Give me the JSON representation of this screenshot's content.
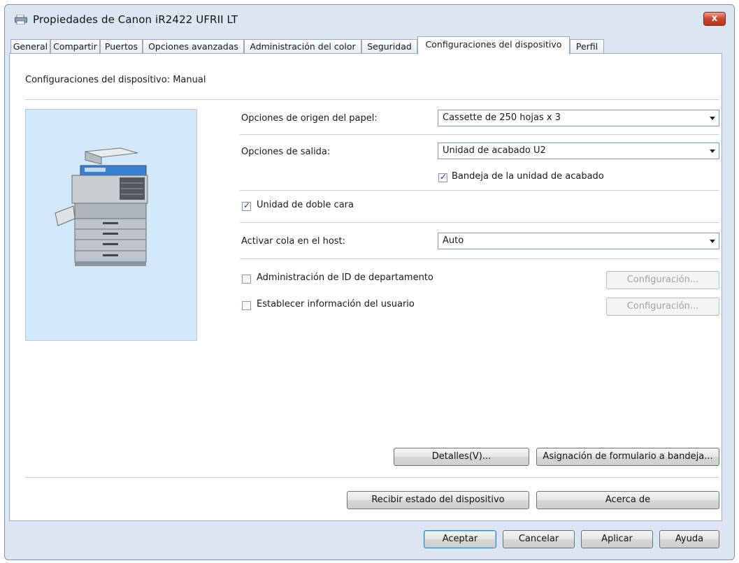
{
  "window": {
    "title": "Propiedades de Canon iR2422 UFRII LT",
    "close_label": "x"
  },
  "tabs": [
    {
      "label": "General"
    },
    {
      "label": "Compartir"
    },
    {
      "label": "Puertos"
    },
    {
      "label": "Opciones avanzadas"
    },
    {
      "label": "Administración del color"
    },
    {
      "label": "Seguridad"
    },
    {
      "label": "Configuraciones del dispositivo"
    },
    {
      "label": "Perfil"
    }
  ],
  "header": {
    "text": "Configuraciones del dispositivo: Manual"
  },
  "paper_source": {
    "label": "Opciones de origen del papel:",
    "value": "Cassette de 250 hojas x 3"
  },
  "output": {
    "label": "Opciones de salida:",
    "value": "Unidad de acabado U2"
  },
  "finisher_tray": {
    "label": "Bandeja de la unidad de acabado",
    "checked": true
  },
  "duplex_unit": {
    "label": "Unidad de doble cara",
    "checked": true
  },
  "host_spool": {
    "label": "Activar cola en el host:",
    "value": "Auto"
  },
  "dept_id": {
    "label": "Administración de ID de departamento",
    "checked": false,
    "button": "Configuración..."
  },
  "user_info": {
    "label": "Establecer información del usuario",
    "checked": false,
    "button": "Configuración..."
  },
  "buttons": {
    "details": "Detalles(V)...",
    "form_to_tray": "Asignación de formulario a bandeja...",
    "get_status": "Recibir estado del dispositivo",
    "about": "Acerca de",
    "ok": "Aceptar",
    "cancel": "Cancelar",
    "apply": "Aplicar",
    "help": "Ayuda"
  }
}
